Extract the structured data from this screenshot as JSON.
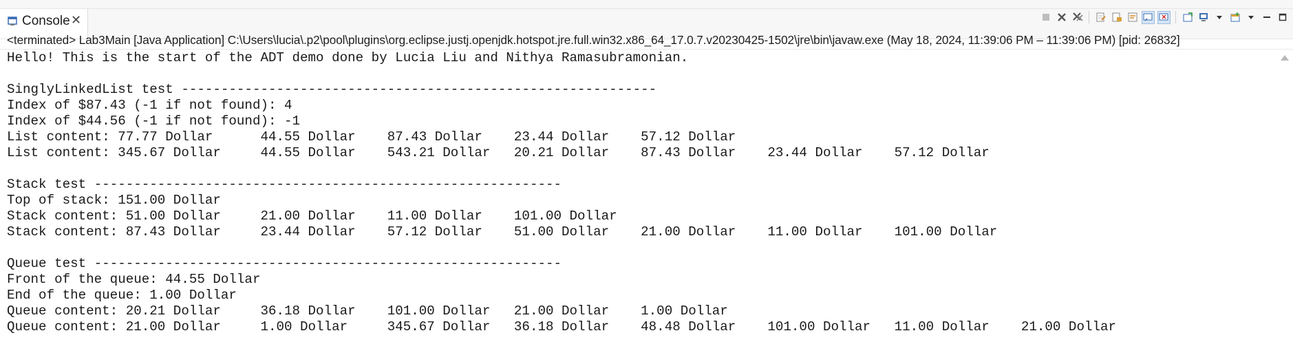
{
  "tab": {
    "label": "Console",
    "close": "✕"
  },
  "toolbar": {
    "buttons": [
      "terminate-icon",
      "remove-launch-icon",
      "remove-all-terminated-icon",
      "clear-console-icon",
      "scroll-lock-icon",
      "word-wrap-icon",
      "show-on-stdout-icon",
      "show-on-stderr-icon",
      "pin-console-icon",
      "display-console-icon",
      "display-console-dropdown-icon",
      "open-console-icon",
      "open-console-dropdown-icon",
      "minimize-icon",
      "maximize-icon"
    ]
  },
  "status": "<terminated> Lab3Main [Java Application] C:\\Users\\lucia\\.p2\\pool\\plugins\\org.eclipse.justj.openjdk.hotspot.jre.full.win32.x86_64_17.0.7.v20230425-1502\\jre\\bin\\javaw.exe  (May 18, 2024, 11:39:06 PM – 11:39:06 PM) [pid: 26832]",
  "console": {
    "lines": [
      "Hello! This is the start of the ADT demo done by Lucia Liu and Nithya Ramasubramonian.",
      "",
      "SinglyLinkedList test ------------------------------------------------------------",
      "Index of $87.43 (-1 if not found): 4",
      "Index of $44.56 (-1 if not found): -1",
      "List content: 77.77 Dollar      44.55 Dollar    87.43 Dollar    23.44 Dollar    57.12 Dollar",
      "List content: 345.67 Dollar     44.55 Dollar    543.21 Dollar   20.21 Dollar    87.43 Dollar    23.44 Dollar    57.12 Dollar",
      "",
      "Stack test -----------------------------------------------------------",
      "Top of stack: 151.00 Dollar",
      "Stack content: 51.00 Dollar     21.00 Dollar    11.00 Dollar    101.00 Dollar",
      "Stack content: 87.43 Dollar     23.44 Dollar    57.12 Dollar    51.00 Dollar    21.00 Dollar    11.00 Dollar    101.00 Dollar",
      "",
      "Queue test -----------------------------------------------------------",
      "Front of the queue: 44.55 Dollar",
      "End of the queue: 1.00 Dollar",
      "Queue content: 20.21 Dollar     36.18 Dollar    101.00 Dollar   21.00 Dollar    1.00 Dollar",
      "Queue content: 21.00 Dollar     1.00 Dollar     345.67 Dollar   36.18 Dollar    48.48 Dollar    101.00 Dollar   11.00 Dollar    21.00 Dollar"
    ]
  },
  "colors": {
    "accent": "#3c6fb6",
    "text": "#1a1a1a",
    "tabbar_bg": "#f7f7f7"
  }
}
